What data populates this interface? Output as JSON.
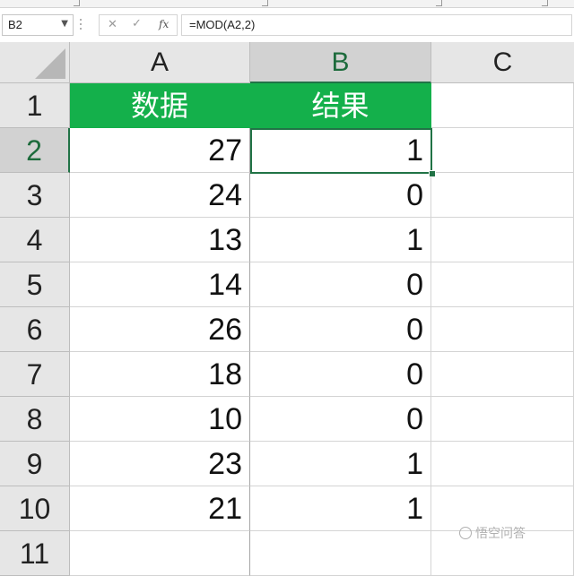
{
  "formula_bar": {
    "name_box": "B2",
    "formula": "=MOD(A2,2)",
    "fx_label": "fx",
    "cancel_icon": "x-icon",
    "enter_icon": "check-icon"
  },
  "columns": [
    "A",
    "B",
    "C"
  ],
  "rows": [
    "1",
    "2",
    "3",
    "4",
    "5",
    "6",
    "7",
    "8",
    "9",
    "10",
    "11"
  ],
  "selected_cell": "B2",
  "header_row": {
    "a": "数据",
    "b": "结果",
    "fill": "#14b04b"
  },
  "data": [
    {
      "a": "27",
      "b": "1"
    },
    {
      "a": "24",
      "b": "0"
    },
    {
      "a": "13",
      "b": "1"
    },
    {
      "a": "14",
      "b": "0"
    },
    {
      "a": "26",
      "b": "0"
    },
    {
      "a": "18",
      "b": "0"
    },
    {
      "a": "10",
      "b": "0"
    },
    {
      "a": "23",
      "b": "1"
    },
    {
      "a": "21",
      "b": "1"
    }
  ],
  "watermark": "悟空问答",
  "colors": {
    "accent": "#217346",
    "header_fill": "#14b04b"
  }
}
